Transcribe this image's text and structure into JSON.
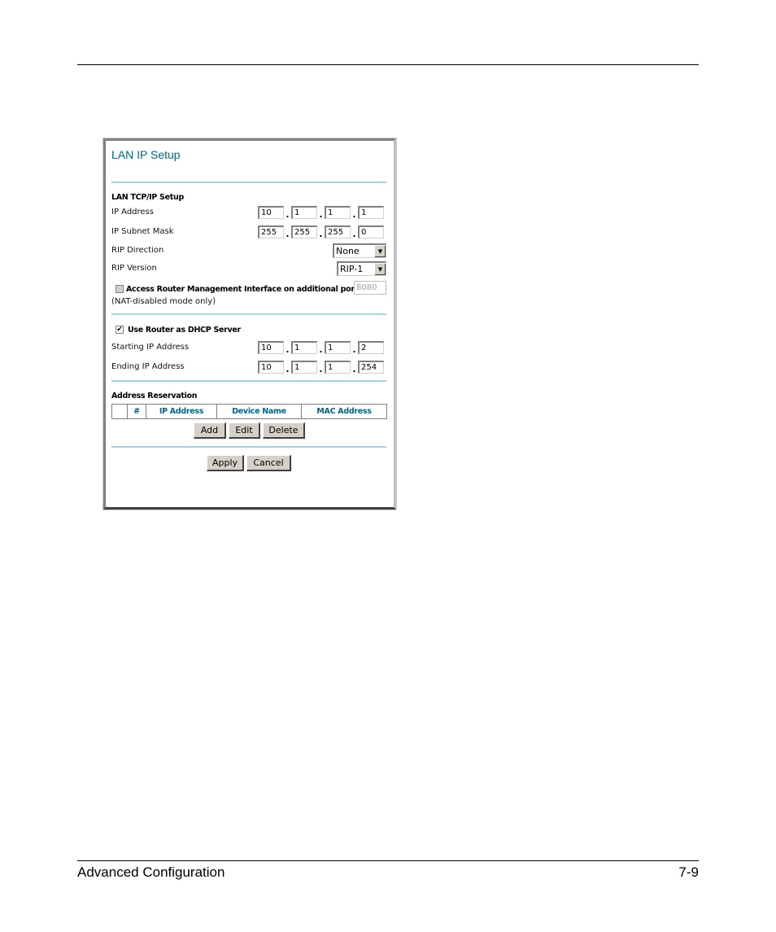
{
  "footer": {
    "section": "Advanced Configuration",
    "page": "7-9"
  },
  "panel": {
    "title": "LAN IP Setup",
    "lan_section": {
      "heading": "LAN TCP/IP Setup",
      "ip_address": {
        "label": "IP Address",
        "octets": [
          "10",
          "1",
          "1",
          "1"
        ]
      },
      "subnet_mask": {
        "label": "IP Subnet Mask",
        "octets": [
          "255",
          "255",
          "255",
          "0"
        ]
      },
      "rip_direction": {
        "label": "RIP Direction",
        "value": "None"
      },
      "rip_version": {
        "label": "RIP Version",
        "value": "RIP-1"
      },
      "remote_mgmt": {
        "label": "Access Router Management Interface on additional port",
        "checked": false,
        "port": "8080",
        "note": "(NAT-disabled mode only)"
      }
    },
    "dhcp_section": {
      "checkbox_label": "Use Router as DHCP Server",
      "checked": true,
      "starting": {
        "label": "Starting IP Address",
        "octets": [
          "10",
          "1",
          "1",
          "2"
        ]
      },
      "ending": {
        "label": "Ending IP Address",
        "octets": [
          "10",
          "1",
          "1",
          "254"
        ]
      }
    },
    "reservation": {
      "heading": "Address Reservation",
      "columns": [
        "",
        "#",
        "IP Address",
        "Device Name",
        "MAC Address"
      ],
      "buttons": {
        "add": "Add",
        "edit": "Edit",
        "delete": "Delete"
      }
    },
    "buttons": {
      "apply": "Apply",
      "cancel": "Cancel"
    },
    "check_glyph": "✔",
    "arrow_glyph": "▼",
    "dot": "."
  }
}
